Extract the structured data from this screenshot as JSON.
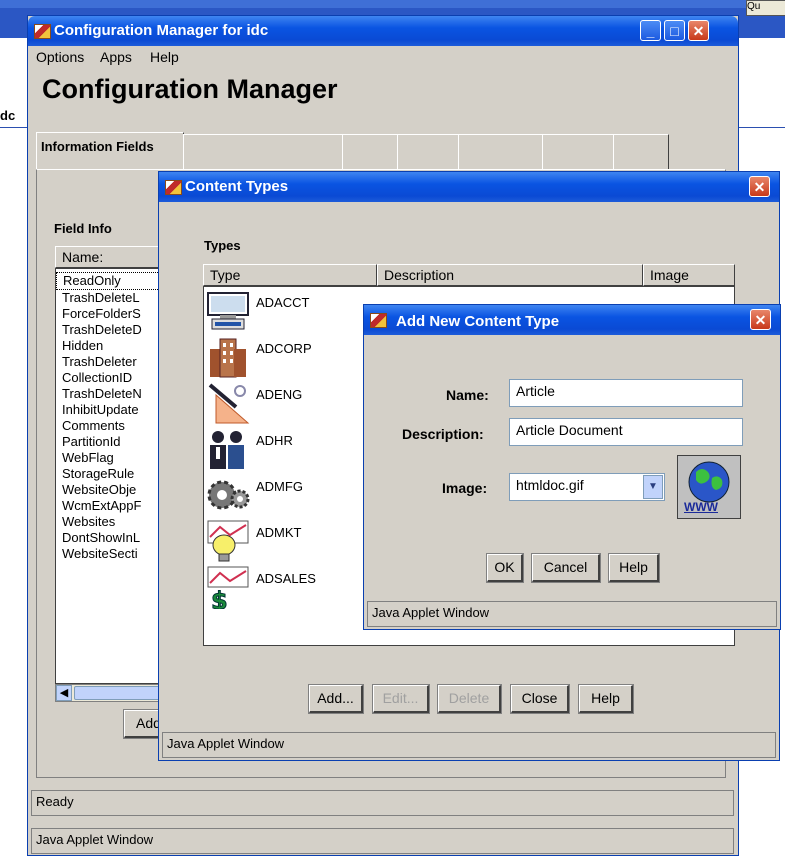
{
  "background": {
    "left_text": "dc",
    "right_button": "Qu"
  },
  "config_window": {
    "title": "Configuration Manager for idc",
    "menu": [
      "Options",
      "Apps",
      "Help"
    ],
    "heading": "Configuration Manager",
    "active_tab": "Information Fields",
    "field_info_label": "Field Info",
    "name_column": "Name:",
    "fields": [
      "ReadOnly",
      "TrashDeleteL",
      "ForceFolderS",
      "TrashDeleteD",
      "Hidden",
      "TrashDeleter",
      "CollectionID",
      "TrashDeleteN",
      "InhibitUpdate",
      "Comments",
      "PartitionId",
      "WebFlag",
      "StorageRule",
      "WebsiteObje",
      "WcmExtAppF",
      "Websites",
      "DontShowInL",
      "WebsiteSecti"
    ],
    "add_button": "Add",
    "status": "Ready",
    "applet_label": "Java Applet Window"
  },
  "content_types": {
    "title": "Content Types",
    "types_label": "Types",
    "columns": {
      "type": "Type",
      "description": "Description",
      "image": "Image"
    },
    "rows": [
      {
        "name": "ADACCT",
        "icon": "computer-icon"
      },
      {
        "name": "ADCORP",
        "icon": "building-icon"
      },
      {
        "name": "ADENG",
        "icon": "drafting-icon"
      },
      {
        "name": "ADHR",
        "icon": "people-icon"
      },
      {
        "name": "ADMFG",
        "icon": "gears-icon"
      },
      {
        "name": "ADMKT",
        "icon": "lightbulb-chart-icon"
      },
      {
        "name": "ADSALES",
        "icon": "dollar-chart-icon"
      }
    ],
    "buttons": {
      "add": "Add...",
      "edit": "Edit...",
      "delete": "Delete",
      "close": "Close",
      "help": "Help"
    },
    "applet_label": "Java Applet Window"
  },
  "add_dialog": {
    "title": "Add New Content Type",
    "name_label": "Name:",
    "name_value": "Article",
    "description_label": "Description:",
    "description_value": "Article Document",
    "image_label": "Image:",
    "image_value": "htmldoc.gif",
    "preview_caption": "WWW",
    "buttons": {
      "ok": "OK",
      "cancel": "Cancel",
      "help": "Help"
    },
    "applet_label": "Java Applet Window"
  },
  "colors": {
    "title_blue": "#0a54e2",
    "window_gray": "#d4d0c8"
  }
}
